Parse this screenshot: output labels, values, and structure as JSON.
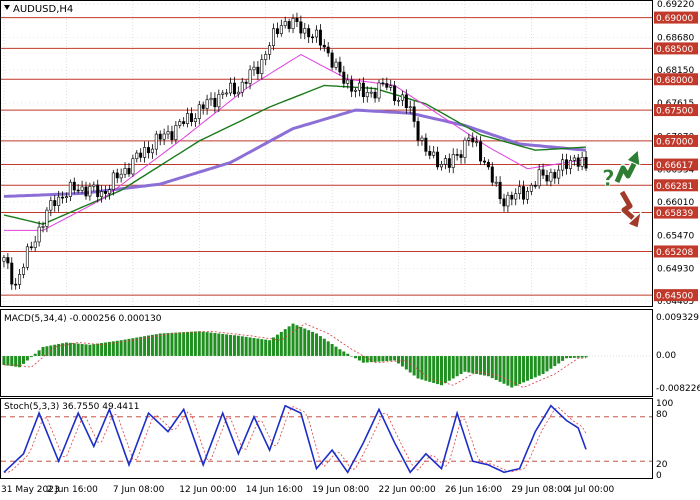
{
  "symbol": "AUDUSD,H4",
  "colors": {
    "candle": "#000000",
    "grid": "#c0c0c0",
    "level_line": "#c0392b",
    "level_label_bg": "#c0392b",
    "ma_fast": "#e040e0",
    "ma_mid": "#1a7a1a",
    "ma_slow": "#8c6fd6",
    "macd_hist": "#1f8f1f",
    "macd_signal": "#d23c3c",
    "stoch_main": "#1c2dc8",
    "stoch_signal": "#e04040",
    "stoch_level": "#c0392b",
    "arrow_up": "#2e7d32",
    "arrow_down": "#a23a2a",
    "question_mark": "#2e7d32"
  },
  "price_axis": {
    "labels": [
      "0.69220",
      "0.68680",
      "0.68150",
      "0.67615",
      "0.67070",
      "0.66534",
      "0.66010",
      "0.65470",
      "0.64930",
      "0.64405"
    ]
  },
  "levels": [
    {
      "value": 0.69,
      "label": "0.69000"
    },
    {
      "value": 0.685,
      "label": "0.68500"
    },
    {
      "value": 0.68,
      "label": "0.68000"
    },
    {
      "value": 0.675,
      "label": "0.67500"
    },
    {
      "value": 0.67,
      "label": "0.67000"
    },
    {
      "value": 0.66617,
      "label": "0.66617"
    },
    {
      "value": 0.66281,
      "label": "0.66281"
    },
    {
      "value": 0.65839,
      "label": "0.65839"
    },
    {
      "value": 0.65208,
      "label": "0.65208"
    },
    {
      "value": 0.645,
      "label": "0.64500"
    }
  ],
  "macd": {
    "title": "MACD(5,34,4) -0.000256 0.000130",
    "axis_labels": [
      "0.009329",
      "0.00",
      "-0.008226"
    ]
  },
  "stoch": {
    "title": "Stoch(5,3,3) 36.7550 49.4411",
    "axis_labels": [
      "100",
      "80",
      "20",
      "0"
    ]
  },
  "time_labels": [
    "31 May 2023",
    "2 Jun 16:00",
    "7 Jun 08:00",
    "12 Jun 00:00",
    "14 Jun 16:00",
    "19 Jun 08:00",
    "22 Jun 00:00",
    "26 Jun 16:00",
    "29 Jun 08:00",
    "4 Jul 00:00"
  ],
  "chart_data": {
    "type": "candlestick",
    "symbol": "AUDUSD",
    "timeframe": "H4",
    "approx_close_path": [
      {
        "bar": 0,
        "close": 0.6505
      },
      {
        "bar": 3,
        "close": 0.6468
      },
      {
        "bar": 8,
        "close": 0.6545
      },
      {
        "bar": 13,
        "close": 0.6605
      },
      {
        "bar": 19,
        "close": 0.6625
      },
      {
        "bar": 25,
        "close": 0.6615
      },
      {
        "bar": 32,
        "close": 0.666
      },
      {
        "bar": 38,
        "close": 0.6695
      },
      {
        "bar": 46,
        "close": 0.673
      },
      {
        "bar": 54,
        "close": 0.677
      },
      {
        "bar": 61,
        "close": 0.679
      },
      {
        "bar": 66,
        "close": 0.683
      },
      {
        "bar": 71,
        "close": 0.6893
      },
      {
        "bar": 76,
        "close": 0.6885
      },
      {
        "bar": 82,
        "close": 0.6855
      },
      {
        "bar": 86,
        "close": 0.6805
      },
      {
        "bar": 92,
        "close": 0.6775
      },
      {
        "bar": 98,
        "close": 0.679
      },
      {
        "bar": 104,
        "close": 0.675
      },
      {
        "bar": 108,
        "close": 0.668
      },
      {
        "bar": 114,
        "close": 0.666
      },
      {
        "bar": 119,
        "close": 0.6705
      },
      {
        "bar": 123,
        "close": 0.667
      },
      {
        "bar": 127,
        "close": 0.6605
      },
      {
        "bar": 133,
        "close": 0.6615
      },
      {
        "bar": 137,
        "close": 0.664
      },
      {
        "bar": 142,
        "close": 0.665
      },
      {
        "bar": 146,
        "close": 0.6675
      },
      {
        "bar": 149,
        "close": 0.6653
      }
    ],
    "ma_fast_path": [
      {
        "bar": 0,
        "value": 0.6555
      },
      {
        "bar": 10,
        "value": 0.6555
      },
      {
        "bar": 25,
        "value": 0.6605
      },
      {
        "bar": 45,
        "value": 0.67
      },
      {
        "bar": 62,
        "value": 0.6785
      },
      {
        "bar": 76,
        "value": 0.684
      },
      {
        "bar": 88,
        "value": 0.68
      },
      {
        "bar": 100,
        "value": 0.679
      },
      {
        "bar": 112,
        "value": 0.674
      },
      {
        "bar": 124,
        "value": 0.669
      },
      {
        "bar": 134,
        "value": 0.6655
      },
      {
        "bar": 149,
        "value": 0.667
      }
    ],
    "ma_mid_path": [
      {
        "bar": 0,
        "value": 0.658
      },
      {
        "bar": 10,
        "value": 0.6565
      },
      {
        "bar": 30,
        "value": 0.662
      },
      {
        "bar": 50,
        "value": 0.67
      },
      {
        "bar": 68,
        "value": 0.6755
      },
      {
        "bar": 82,
        "value": 0.679
      },
      {
        "bar": 95,
        "value": 0.6785
      },
      {
        "bar": 108,
        "value": 0.676
      },
      {
        "bar": 122,
        "value": 0.671
      },
      {
        "bar": 136,
        "value": 0.6685
      },
      {
        "bar": 149,
        "value": 0.669
      }
    ],
    "ma_slow_path": [
      {
        "bar": 0,
        "value": 0.661
      },
      {
        "bar": 20,
        "value": 0.6615
      },
      {
        "bar": 40,
        "value": 0.663
      },
      {
        "bar": 58,
        "value": 0.6665
      },
      {
        "bar": 74,
        "value": 0.672
      },
      {
        "bar": 90,
        "value": 0.675
      },
      {
        "bar": 104,
        "value": 0.6745
      },
      {
        "bar": 118,
        "value": 0.6725
      },
      {
        "bar": 132,
        "value": 0.6695
      },
      {
        "bar": 149,
        "value": 0.6685
      }
    ],
    "macd_hist_path": [
      {
        "bar": 0,
        "value": -0.002
      },
      {
        "bar": 4,
        "value": -0.0025
      },
      {
        "bar": 10,
        "value": 0.002
      },
      {
        "bar": 16,
        "value": 0.003
      },
      {
        "bar": 22,
        "value": 0.0025
      },
      {
        "bar": 30,
        "value": 0.0035
      },
      {
        "bar": 40,
        "value": 0.005
      },
      {
        "bar": 50,
        "value": 0.0055
      },
      {
        "bar": 60,
        "value": 0.0045
      },
      {
        "bar": 68,
        "value": 0.0035
      },
      {
        "bar": 74,
        "value": 0.0072
      },
      {
        "bar": 80,
        "value": 0.005
      },
      {
        "bar": 86,
        "value": 0.0015
      },
      {
        "bar": 92,
        "value": -0.0015
      },
      {
        "bar": 100,
        "value": -0.001
      },
      {
        "bar": 106,
        "value": -0.005
      },
      {
        "bar": 112,
        "value": -0.0065
      },
      {
        "bar": 118,
        "value": -0.0035
      },
      {
        "bar": 124,
        "value": -0.0045
      },
      {
        "bar": 130,
        "value": -0.007
      },
      {
        "bar": 138,
        "value": -0.004
      },
      {
        "bar": 144,
        "value": -0.0005
      },
      {
        "bar": 149,
        "value": -0.0003
      }
    ],
    "stoch_main_path": [
      {
        "bar": 0,
        "value": 5
      },
      {
        "bar": 5,
        "value": 30
      },
      {
        "bar": 9,
        "value": 85
      },
      {
        "bar": 14,
        "value": 20
      },
      {
        "bar": 19,
        "value": 85
      },
      {
        "bar": 23,
        "value": 40
      },
      {
        "bar": 27,
        "value": 90
      },
      {
        "bar": 32,
        "value": 15
      },
      {
        "bar": 37,
        "value": 85
      },
      {
        "bar": 42,
        "value": 60
      },
      {
        "bar": 46,
        "value": 90
      },
      {
        "bar": 51,
        "value": 15
      },
      {
        "bar": 56,
        "value": 85
      },
      {
        "bar": 60,
        "value": 30
      },
      {
        "bar": 64,
        "value": 80
      },
      {
        "bar": 68,
        "value": 35
      },
      {
        "bar": 72,
        "value": 95
      },
      {
        "bar": 76,
        "value": 85
      },
      {
        "bar": 80,
        "value": 10
      },
      {
        "bar": 84,
        "value": 35
      },
      {
        "bar": 88,
        "value": 5
      },
      {
        "bar": 92,
        "value": 45
      },
      {
        "bar": 96,
        "value": 90
      },
      {
        "bar": 100,
        "value": 45
      },
      {
        "bar": 104,
        "value": 5
      },
      {
        "bar": 108,
        "value": 30
      },
      {
        "bar": 112,
        "value": 10
      },
      {
        "bar": 116,
        "value": 85
      },
      {
        "bar": 120,
        "value": 20
      },
      {
        "bar": 124,
        "value": 15
      },
      {
        "bar": 128,
        "value": 5
      },
      {
        "bar": 132,
        "value": 10
      },
      {
        "bar": 136,
        "value": 60
      },
      {
        "bar": 140,
        "value": 95
      },
      {
        "bar": 144,
        "value": 75
      },
      {
        "bar": 147,
        "value": 65
      },
      {
        "bar": 149,
        "value": 36
      }
    ]
  }
}
